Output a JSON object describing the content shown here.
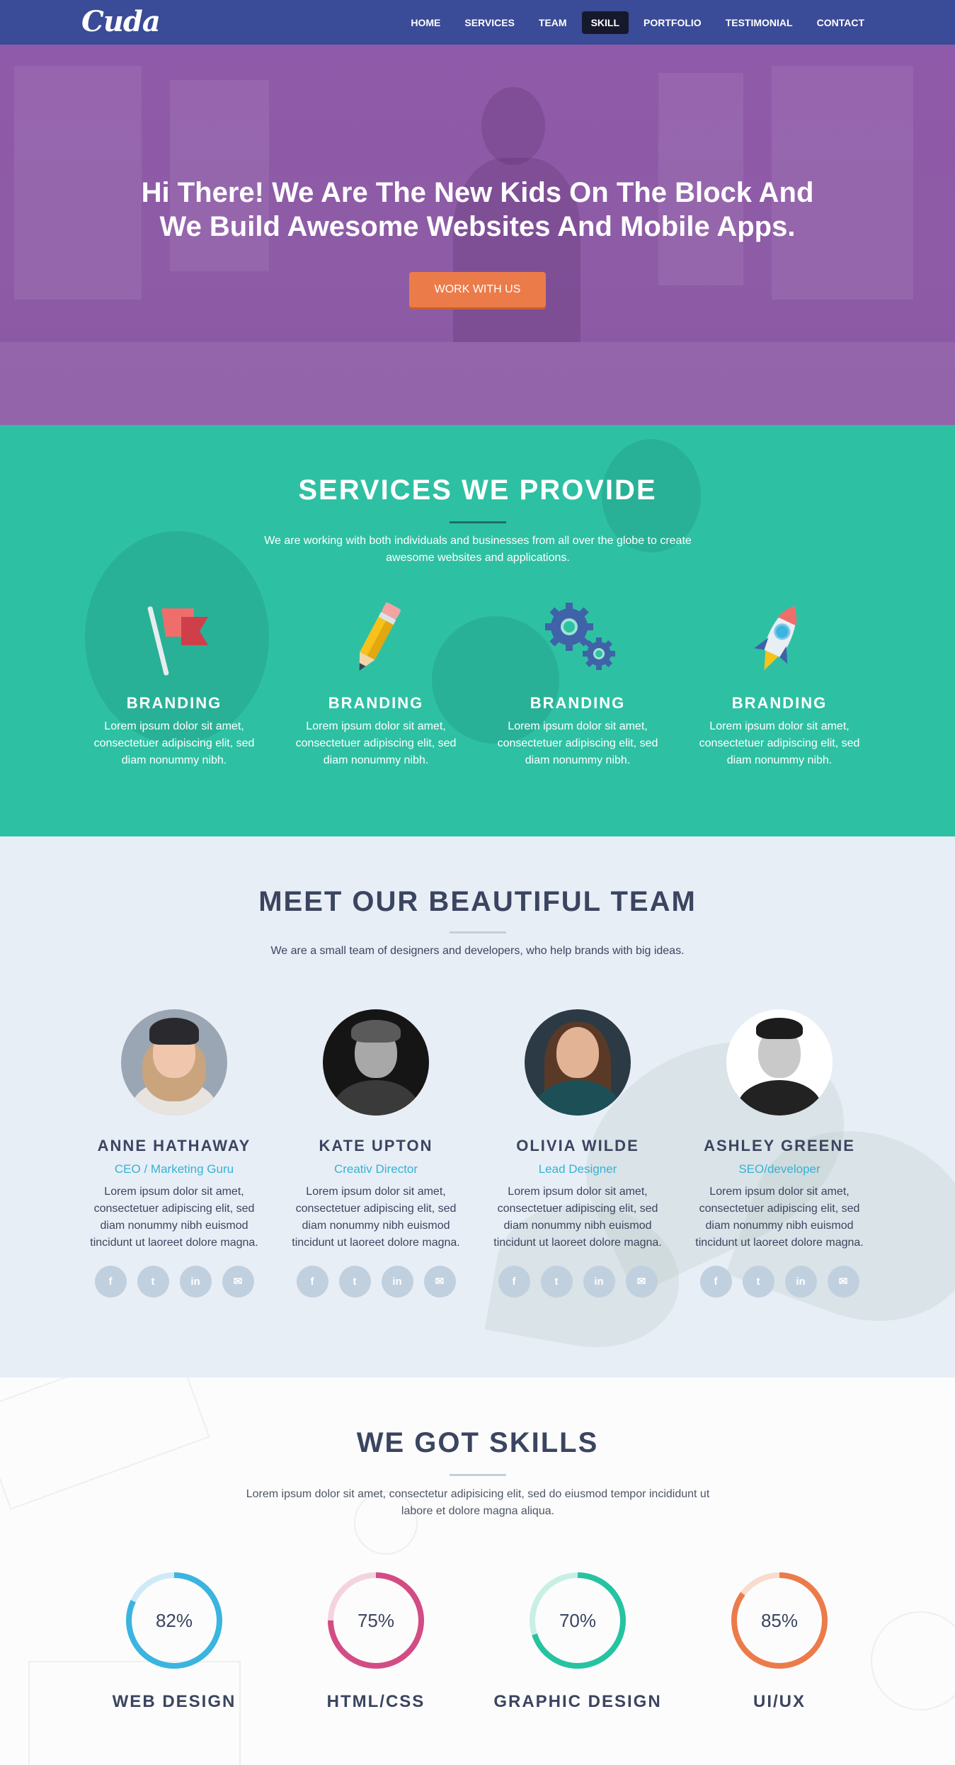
{
  "nav": {
    "logo": "Cuda",
    "items": [
      "HOME",
      "SERVICES",
      "TEAM",
      "SKILL",
      "PORTFOLIO",
      "TESTIMONIAL",
      "CONTACT"
    ],
    "active": "SKILL"
  },
  "hero": {
    "headline_line1": "Hi There! We Are The New Kids On The Block And",
    "headline_line2": "We Build Awesome Websites And Mobile Apps.",
    "cta": "WORK WITH US"
  },
  "services": {
    "title": "SERVICES WE PROVIDE",
    "subtitle": "We are working with both individuals and businesses from all over the globe to create awesome websites and applications.",
    "items": [
      {
        "icon": "flag-icon",
        "title": "BRANDING",
        "text": "Lorem ipsum dolor sit amet, consectetuer adipiscing elit, sed diam nonummy nibh."
      },
      {
        "icon": "pencil-icon",
        "title": "BRANDING",
        "text": "Lorem ipsum dolor sit amet, consectetuer adipiscing elit, sed diam nonummy nibh."
      },
      {
        "icon": "gears-icon",
        "title": "BRANDING",
        "text": "Lorem ipsum dolor sit amet, consectetuer adipiscing elit, sed diam nonummy nibh."
      },
      {
        "icon": "rocket-icon",
        "title": "BRANDING",
        "text": "Lorem ipsum dolor sit amet, consectetuer adipiscing elit, sed diam nonummy nibh."
      }
    ]
  },
  "team": {
    "title": "MEET OUR BEAUTIFUL TEAM",
    "subtitle": "We are a small team of designers and developers, who help brands with big ideas.",
    "members": [
      {
        "name": "ANNE HATHAWAY",
        "role": "CEO / Marketing Guru",
        "bio": "Lorem ipsum dolor sit amet, consectetuer adipiscing elit, sed diam nonummy nibh euismod tincidunt ut laoreet dolore magna."
      },
      {
        "name": "KATE UPTON",
        "role": "Creativ Director",
        "bio": "Lorem ipsum dolor sit amet, consectetuer adipiscing elit, sed diam nonummy nibh euismod tincidunt ut laoreet dolore magna."
      },
      {
        "name": "OLIVIA WILDE",
        "role": "Lead Designer",
        "bio": "Lorem ipsum dolor sit amet, consectetuer adipiscing elit, sed diam nonummy nibh euismod tincidunt ut laoreet dolore magna."
      },
      {
        "name": "ASHLEY GREENE",
        "role": "SEO/developer",
        "bio": "Lorem ipsum dolor sit amet, consectetuer adipiscing elit, sed diam nonummy nibh euismod tincidunt ut laoreet dolore magna."
      }
    ],
    "social_icons": [
      "facebook-icon",
      "twitter-icon",
      "linkedin-icon",
      "mail-icon"
    ]
  },
  "skills": {
    "title": "WE GOT SKILLS",
    "subtitle": "Lorem ipsum dolor sit amet, consectetur adipisicing elit, sed do eiusmod tempor incididunt ut labore et dolore magna aliqua.",
    "items": [
      {
        "label": "WEB DESIGN",
        "percent": 82,
        "percent_text": "82%",
        "color": "#3ab4e0",
        "track": "#cdeaf6"
      },
      {
        "label": "HTML/CSS",
        "percent": 75,
        "percent_text": "75%",
        "color": "#d34c84",
        "track": "#f4d3e0"
      },
      {
        "label": "GRAPHIC DESIGN",
        "percent": 70,
        "percent_text": "70%",
        "color": "#26c3a1",
        "track": "#c8efe5"
      },
      {
        "label": "UI/UX",
        "percent": 85,
        "percent_text": "85%",
        "color": "#ec7b4a",
        "track": "#f8dccd"
      }
    ]
  },
  "colors": {
    "nav_bg": "#3a4b97",
    "hero_bg": "#8e5ba6",
    "services_bg": "#2ec0a3",
    "team_bg": "#e8eef5",
    "accent": "#ec7b4a",
    "role_color": "#35b2d6"
  }
}
